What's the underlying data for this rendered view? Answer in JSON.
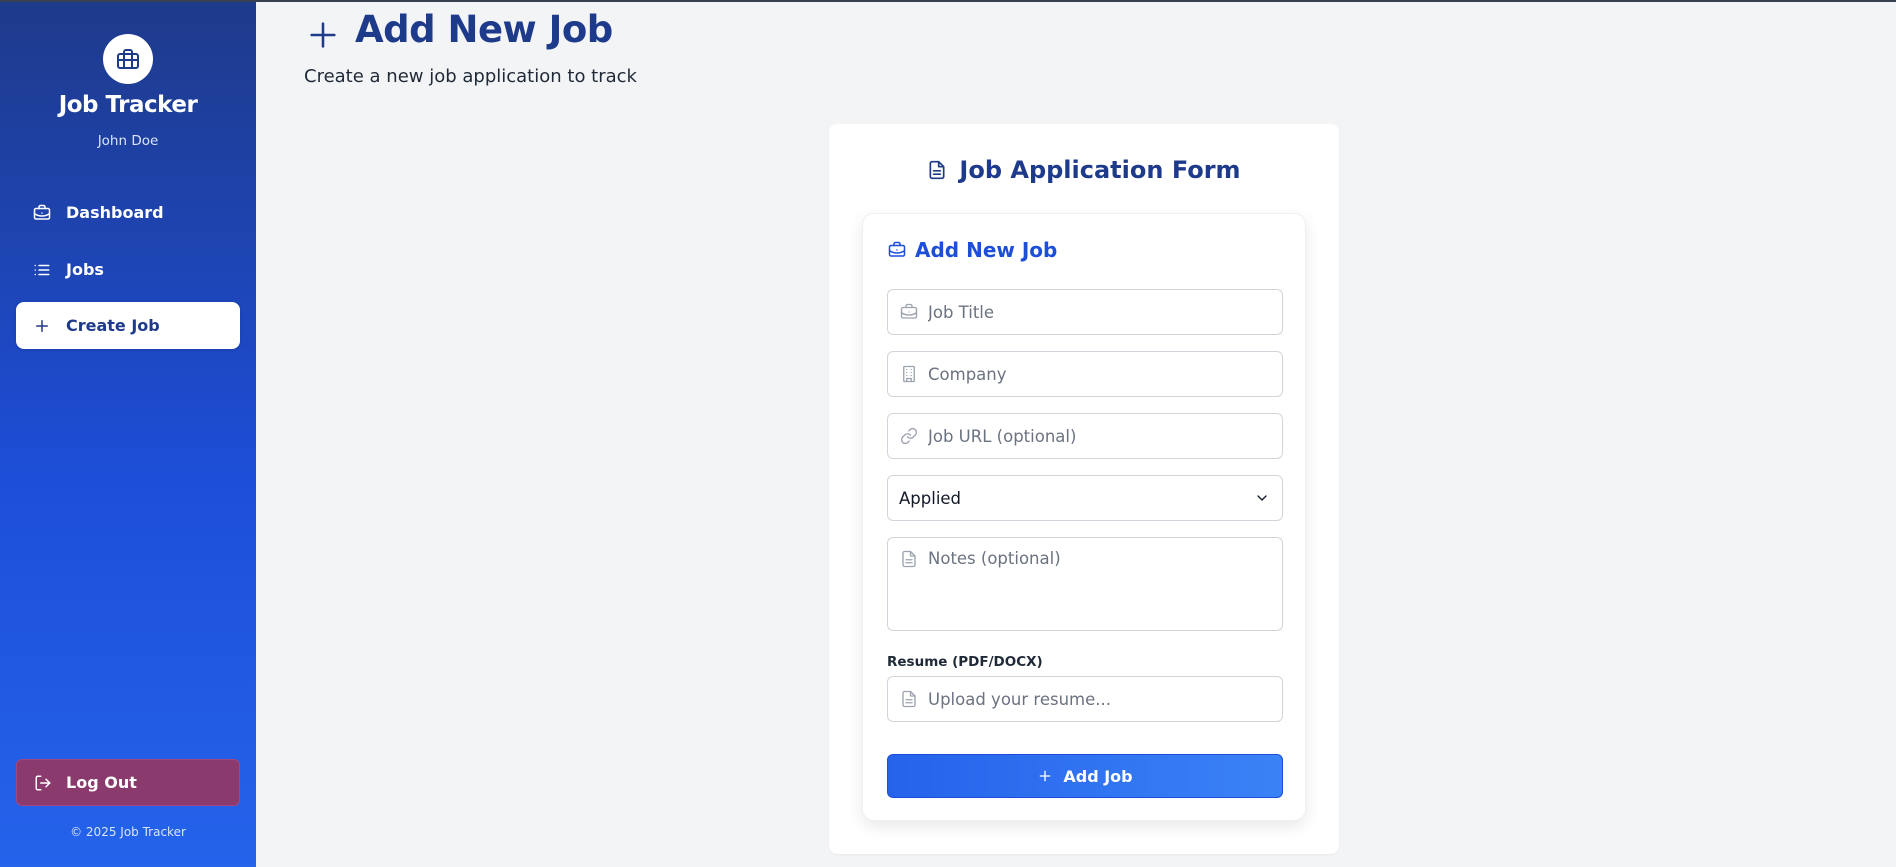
{
  "sidebar": {
    "app_title": "Job Tracker",
    "user_name": "John Doe",
    "nav": [
      {
        "label": "Dashboard",
        "icon": "briefcase-icon"
      },
      {
        "label": "Jobs",
        "icon": "list-icon"
      },
      {
        "label": "Create Job",
        "icon": "plus-icon",
        "active": true
      }
    ],
    "logout_label": "Log Out",
    "copyright": "© 2025 Job Tracker"
  },
  "header": {
    "title": "Add New Job",
    "subtitle": "Create a new job application to track"
  },
  "form": {
    "card_title": "Job Application Form",
    "section_title": "Add New Job",
    "job_title_placeholder": "Job Title",
    "company_placeholder": "Company",
    "url_placeholder": "Job URL (optional)",
    "status_value": "Applied",
    "notes_placeholder": "Notes (optional)",
    "resume_label": "Resume (PDF/DOCX)",
    "resume_placeholder": "Upload your resume...",
    "submit_label": "Add Job"
  },
  "colors": {
    "primary": "#1e3a8a",
    "accent": "#2563eb",
    "logout": "#8b3a6e",
    "background": "#f3f4f6"
  }
}
